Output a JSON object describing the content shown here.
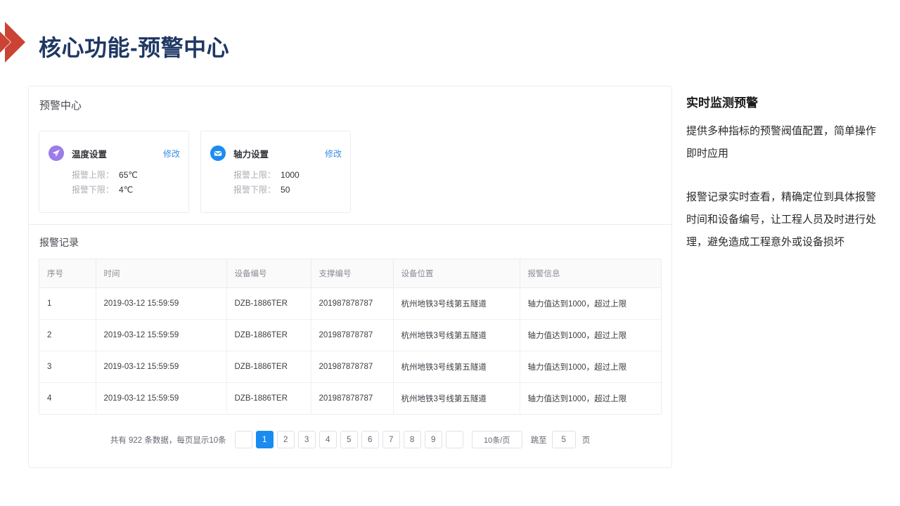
{
  "header": {
    "title": "核心功能-预警中心",
    "logo_icon": "double-chevron-right-icon",
    "title_color": "#1f3864",
    "logo_color": "#cb4334"
  },
  "panel": {
    "title": "预警中心",
    "records_title": "报警记录"
  },
  "setting_cards": [
    {
      "icon": "send-plane-icon",
      "icon_color": "#9b7ce8",
      "name": "温度设置",
      "edit_label": "修改",
      "upper_label": "报警上限：",
      "upper_value": "65℃",
      "lower_label": "报警下限：",
      "lower_value": "4℃"
    },
    {
      "icon": "mail-envelope-icon",
      "icon_color": "#1a8cf0",
      "name": "轴力设置",
      "edit_label": "修改",
      "upper_label": "报警上限：",
      "upper_value": "1000",
      "lower_label": "报警下限：",
      "lower_value": "50"
    }
  ],
  "table": {
    "columns": [
      "序号",
      "时间",
      "设备编号",
      "支撑编号",
      "设备位置",
      "报警信息"
    ],
    "rows": [
      [
        "1",
        "2019-03-12 15:59:59",
        "DZB-1886TER",
        "201987878787",
        "杭州地铁3号线第五隧道",
        "轴力值达到1000，超过上限"
      ],
      [
        "2",
        "2019-03-12 15:59:59",
        "DZB-1886TER",
        "201987878787",
        "杭州地铁3号线第五隧道",
        "轴力值达到1000，超过上限"
      ],
      [
        "3",
        "2019-03-12 15:59:59",
        "DZB-1886TER",
        "201987878787",
        "杭州地铁3号线第五隧道",
        "轴力值达到1000，超过上限"
      ],
      [
        "4",
        "2019-03-12 15:59:59",
        "DZB-1886TER",
        "201987878787",
        "杭州地铁3号线第五隧道",
        "轴力值达到1000，超过上限"
      ]
    ]
  },
  "pagination": {
    "total_text": "共有 922 条数据，每页显示10条",
    "prev_label": "",
    "pages": [
      "1",
      "2",
      "3",
      "4",
      "5",
      "6",
      "7",
      "8",
      "9"
    ],
    "active_page": "1",
    "next_label": "",
    "page_size_label": "10条/页",
    "jump_label": "跳至",
    "jump_value": "5",
    "jump_unit": "页",
    "active_color": "#1a8cf0"
  },
  "side": {
    "title": "实时监测预警",
    "paragraph1": "提供多种指标的预警阀值配置，简单操作即时应用",
    "paragraph2": "报警记录实时查看，精确定位到具体报警时间和设备编号，让工程人员及时进行处理，避免造成工程意外或设备损坏"
  }
}
